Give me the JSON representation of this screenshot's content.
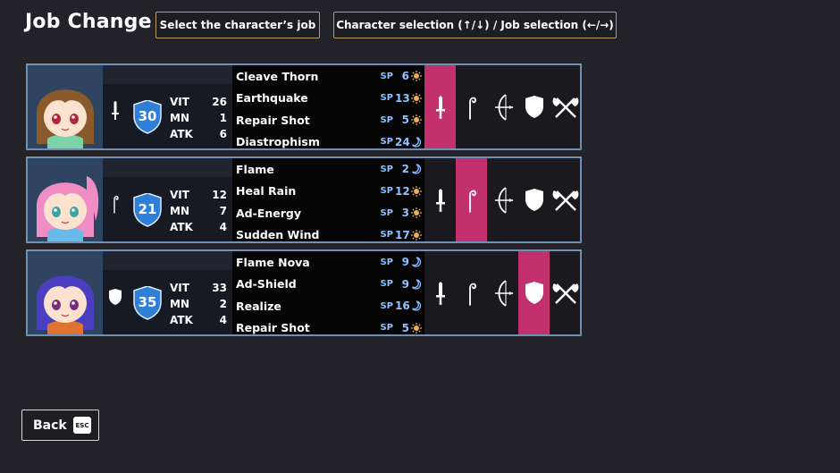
{
  "screen": {
    "title": "Job Change",
    "hint_select": "Select the character’s job",
    "hint_controls": "Character selection (↑/↓) / Job selection (←/→)",
    "back_label": "Back",
    "esc_label": "ESC"
  },
  "job_options": [
    "sword-icon",
    "staff-icon",
    "bow-icon",
    "shield-icon",
    "axe-icon"
  ],
  "colors": {
    "background": "#232228",
    "card_border": "#6f8fb5",
    "selected_job": "#c2306e",
    "level_badge": "#2f7fd8",
    "sp_text": "#8fc0ff",
    "sun": "#e8b05a",
    "moon": "#7fb6ff"
  },
  "characters": [
    {
      "hair": "brown",
      "job_icon": "sword-icon",
      "selected_job": 0,
      "level": "30",
      "stats": [
        {
          "label": "VIT",
          "value": "26"
        },
        {
          "label": "MN",
          "value": "1"
        },
        {
          "label": "ATK",
          "value": "6"
        }
      ],
      "skills": [
        {
          "name": "Cleave Thorn",
          "sp_label": "SP",
          "sp": "6",
          "element": "sun"
        },
        {
          "name": "Earthquake",
          "sp_label": "SP",
          "sp": "13",
          "element": "sun"
        },
        {
          "name": "Repair Shot",
          "sp_label": "SP",
          "sp": "5",
          "element": "sun"
        },
        {
          "name": "Diastrophism",
          "sp_label": "SP",
          "sp": "24",
          "element": "moon"
        }
      ]
    },
    {
      "hair": "pink",
      "job_icon": "staff-icon",
      "selected_job": 1,
      "level": "21",
      "stats": [
        {
          "label": "VIT",
          "value": "12"
        },
        {
          "label": "MN",
          "value": "7"
        },
        {
          "label": "ATK",
          "value": "4"
        }
      ],
      "skills": [
        {
          "name": "Flame",
          "sp_label": "SP",
          "sp": "2",
          "element": "moon"
        },
        {
          "name": "Heal Rain",
          "sp_label": "SP",
          "sp": "12",
          "element": "sun"
        },
        {
          "name": "Ad-Energy",
          "sp_label": "SP",
          "sp": "3",
          "element": "sun"
        },
        {
          "name": "Sudden Wind",
          "sp_label": "SP",
          "sp": "17",
          "element": "sun"
        }
      ]
    },
    {
      "hair": "blue",
      "job_icon": "shield-icon",
      "selected_job": 3,
      "level": "35",
      "stats": [
        {
          "label": "VIT",
          "value": "33"
        },
        {
          "label": "MN",
          "value": "2"
        },
        {
          "label": "ATK",
          "value": "4"
        }
      ],
      "skills": [
        {
          "name": "Flame Nova",
          "sp_label": "SP",
          "sp": "9",
          "element": "moon"
        },
        {
          "name": "Ad-Shield",
          "sp_label": "SP",
          "sp": "9",
          "element": "moon"
        },
        {
          "name": "Realize",
          "sp_label": "SP",
          "sp": "16",
          "element": "moon"
        },
        {
          "name": "Repair Shot",
          "sp_label": "SP",
          "sp": "5",
          "element": "sun"
        }
      ]
    }
  ]
}
